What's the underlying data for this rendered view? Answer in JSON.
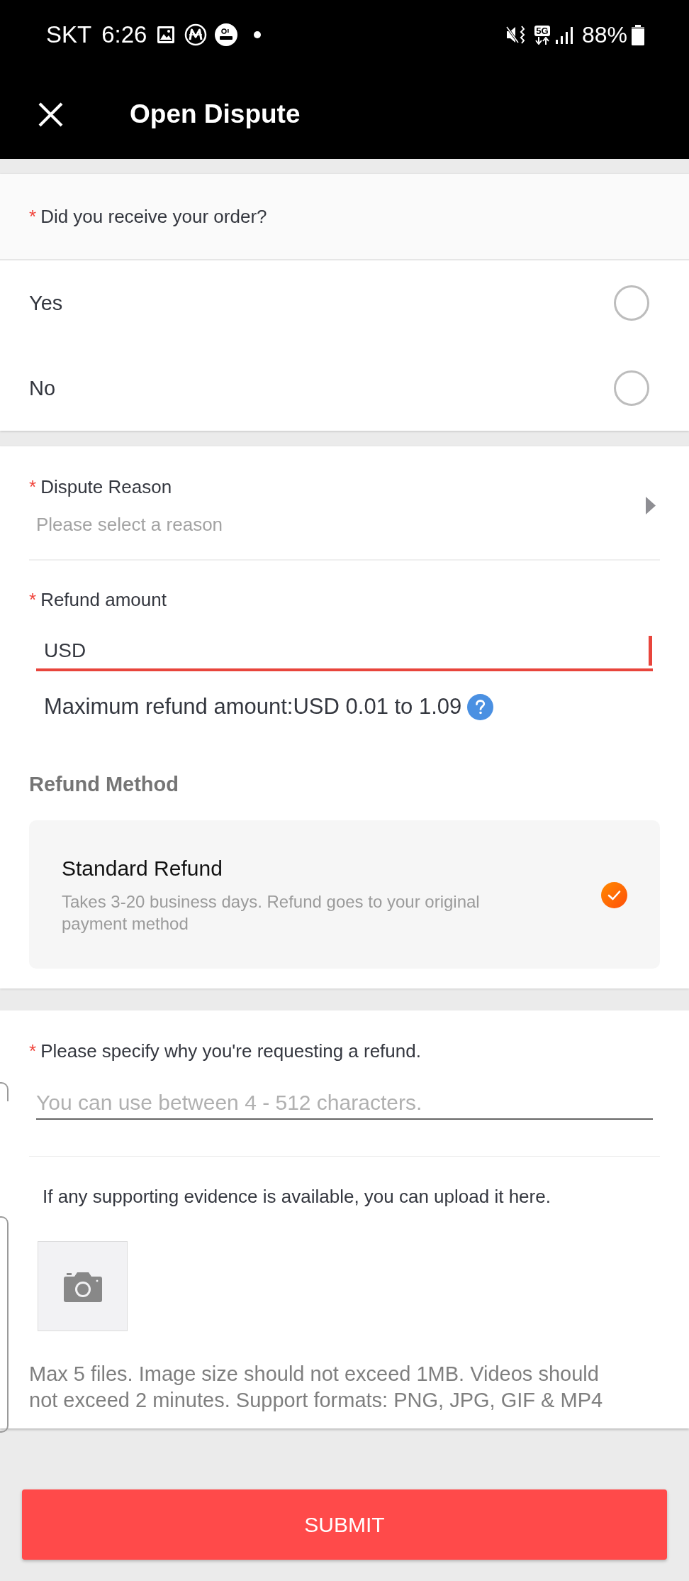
{
  "status_bar": {
    "carrier": "SKT",
    "time": "6:26",
    "network": "5G",
    "battery": "88%"
  },
  "header": {
    "title": "Open Dispute"
  },
  "received_question": {
    "required_mark": "*",
    "label": "Did you receive your order?",
    "options": [
      {
        "label": "Yes",
        "selected": false
      },
      {
        "label": "No",
        "selected": false
      }
    ]
  },
  "dispute_reason": {
    "required_mark": "*",
    "label": "Dispute Reason",
    "placeholder": "Please select a reason"
  },
  "refund_amount": {
    "required_mark": "*",
    "label": "Refund amount",
    "currency": "USD",
    "focused": true,
    "hint": "Maximum refund amount:USD 0.01 to 1.09"
  },
  "refund_method": {
    "title": "Refund Method",
    "options": [
      {
        "name": "Standard Refund",
        "description": "Takes 3-20 business days. Refund goes to your original payment method",
        "selected": true
      }
    ]
  },
  "refund_reason": {
    "required_mark": "*",
    "label": "Please specify why you're requesting a refund.",
    "placeholder": "You can use between 4 - 512 characters."
  },
  "evidence": {
    "prompt": "If any supporting evidence is available, you can upload it here.",
    "note": "Max 5 files. Image size should not exceed 1MB. Videos should not exceed 2 minutes. Support formats: PNG, JPG, GIF & MP4"
  },
  "submit_button": {
    "label": "SUBMIT"
  }
}
